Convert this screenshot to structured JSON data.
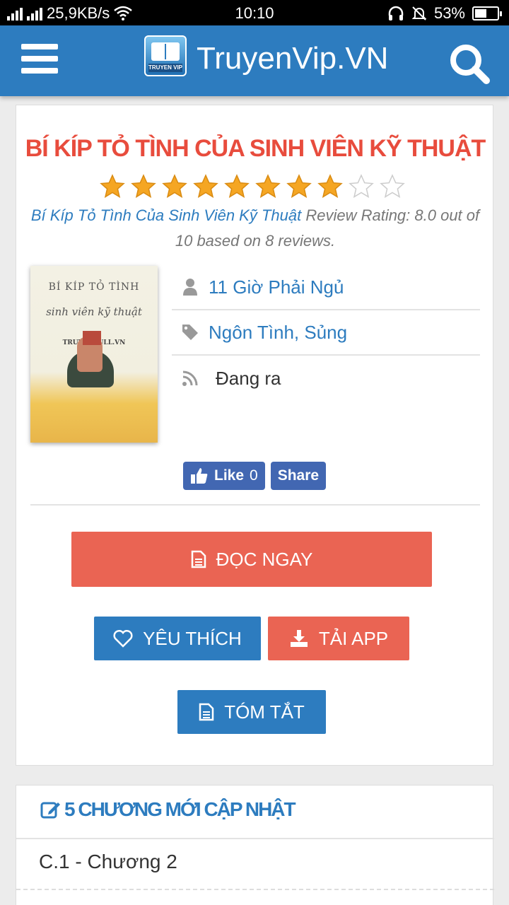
{
  "status_bar": {
    "network_speed": "25,9KB/s",
    "time": "10:10",
    "battery": "53%",
    "battery_level": 0.53,
    "icons": [
      "signal-icon",
      "wifi-icon",
      "headset-icon",
      "mute-icon",
      "battery-icon"
    ]
  },
  "header": {
    "logo_tag": "TRUYEN VIP",
    "site_title": "TruyenVip.VN",
    "icons": [
      "menu-icon",
      "search-icon"
    ]
  },
  "story": {
    "title": "BÍ KÍP TỎ TÌNH CỦA SINH VIÊN KỸ THUẬT",
    "rating_stars": 8,
    "rating_max_stars": 10,
    "review_link": "Bí Kíp Tỏ Tình Của Sinh Viên Kỹ Thuật",
    "review_text": " Review Rating: 8.0 out of 10 based on 8 reviews.",
    "cover": {
      "line1": "BÍ KÍP TỎ TÌNH",
      "line2": "sinh viên kỹ thuật",
      "line3": "TRUYENFULL.VN"
    },
    "author": "11 Giờ Phải Ngủ",
    "genres": "Ngôn Tình, Sủng",
    "status": "Đang ra"
  },
  "social": {
    "like_label": "Like",
    "like_count": "0",
    "share_label": "Share"
  },
  "actions": {
    "read_now": "ĐỌC NGAY",
    "favorite": "YÊU THÍCH",
    "download_app": "TẢI APP",
    "summary": "TÓM TẮT"
  },
  "chapters": {
    "heading": "5 CHƯƠNG MỚI CẬP NHẬT",
    "items": [
      "C.1 - Chương 2"
    ]
  },
  "colors": {
    "brand_blue": "#2d7cbf",
    "accent_red": "#ea6453",
    "title_red": "#e84c3d",
    "facebook": "#4267b2",
    "star_gold": "#f5a623"
  }
}
